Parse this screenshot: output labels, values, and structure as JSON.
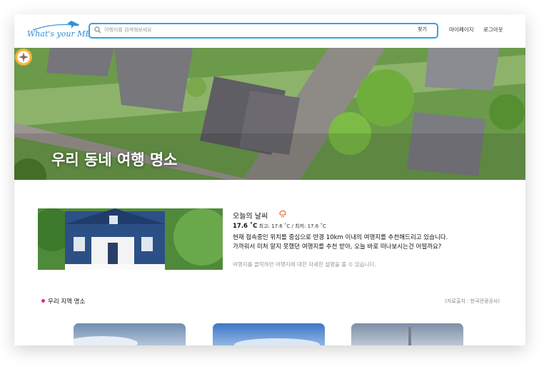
{
  "header": {
    "logo_text": "What's your MBTI",
    "search": {
      "placeholder": "여행지를 검색해보세요",
      "button_label": "찾기"
    },
    "nav": {
      "mypage": "마이페이지",
      "logout": "로그아웃"
    }
  },
  "hero": {
    "title": "우리 동네 여행 명소"
  },
  "weather": {
    "title": "오늘의 날씨",
    "current_temp": "17.6 ˚C",
    "minmax": "최고: 17.6 ˚C / 최저: 17.6 ˚C",
    "desc_line1": "현재 접속중인 위치를 중심으로 반경 10km 이내의 여행지를 추천해드리고 있습니다.",
    "desc_line2": "가까워서 미처 알지 못했던 여행지를 추천 받아, 오늘 바로 떠나보시는건 어떨까요?",
    "hint": "여행지를 클릭하면 여행지에 대한 자세한 설명을 볼 수 있습니다."
  },
  "section": {
    "title": "우리 지역 명소",
    "source": "(자료출처 : 한국관광공사)"
  },
  "colors": {
    "accent": "#3aa1dd",
    "pin": "#e0288c",
    "weather_icon": "#e8531f"
  },
  "icons": [
    "plane-icon",
    "search-icon",
    "compass-icon",
    "cloud-rain-icon",
    "location-pin-icon"
  ]
}
